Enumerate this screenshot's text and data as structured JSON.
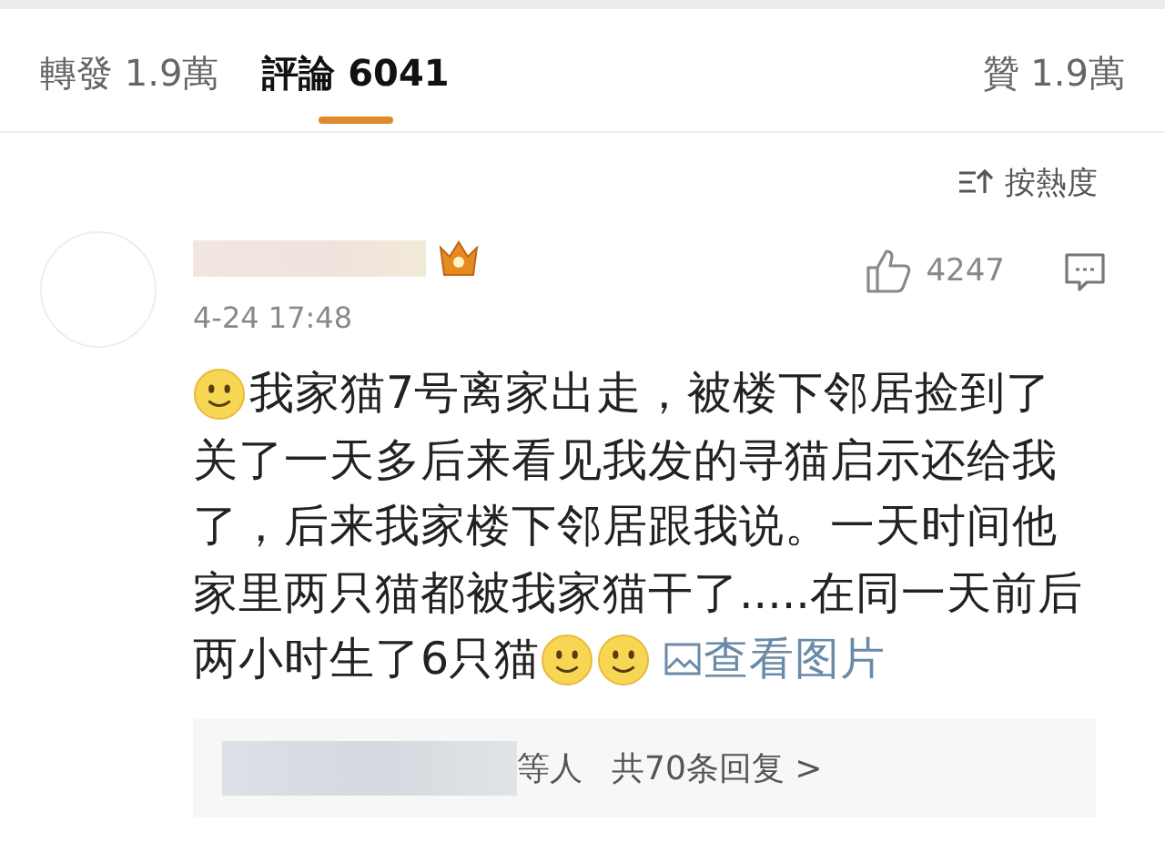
{
  "tabs": [
    {
      "label": "轉發 1.9萬",
      "selected": false
    },
    {
      "label": "評論 6041",
      "selected": true
    },
    {
      "label": "贊 1.9萬",
      "selected": false
    }
  ],
  "sort": {
    "label": "按熱度"
  },
  "comment": {
    "time": "4-24 17:48",
    "likes": "4247",
    "body": [
      [
        {
          "kind": "emoji"
        },
        {
          "kind": "text",
          "text": "我家猫7号离家出走，被楼下邻居捡到了"
        }
      ],
      [
        {
          "kind": "text",
          "text": "关了一天多后来看见我发的寻猫启示还给我"
        }
      ],
      [
        {
          "kind": "text",
          "text": "了，后来我家楼下邻居跟我说。一天时间他"
        }
      ],
      [
        {
          "kind": "text",
          "text": "家里两只猫都被我家猫干了.....在同一天前后"
        }
      ],
      [
        {
          "kind": "text",
          "text": "两小时生了6只猫"
        },
        {
          "kind": "emoji"
        },
        {
          "kind": "emoji"
        },
        {
          "kind": "link",
          "text": "查看图片"
        }
      ]
    ],
    "replies": {
      "who": "等人",
      "count": "共70条回复 >"
    }
  }
}
